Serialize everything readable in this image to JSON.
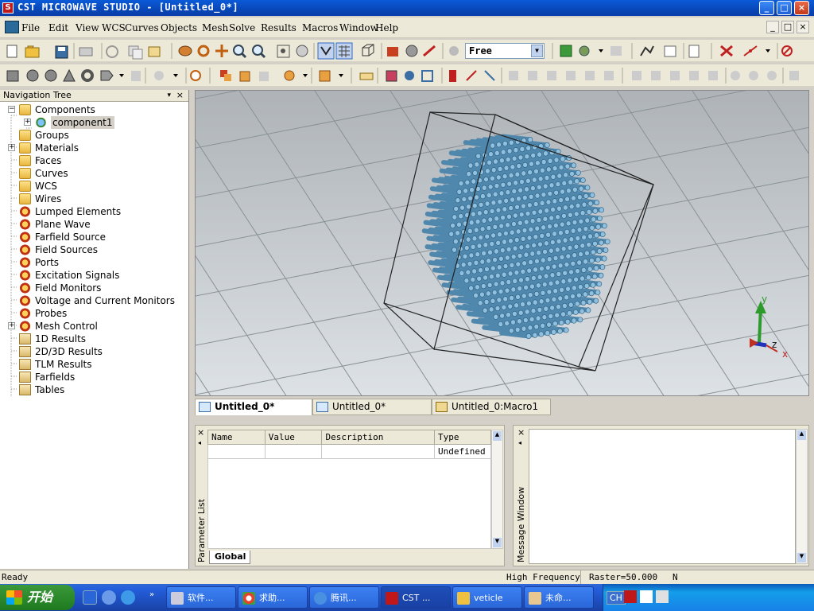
{
  "window": {
    "title": "CST MICROWAVE STUDIO - [Untitled_0*]",
    "logo_letter": "S",
    "controls": [
      "_",
      "□",
      "×"
    ]
  },
  "menubar": {
    "items": [
      "File",
      "Edit",
      "View",
      "WCS",
      "Curves",
      "Objects",
      "Mesh",
      "Solve",
      "Results",
      "Macros",
      "Window",
      "Help"
    ],
    "mdi_controls": [
      "_",
      "□",
      "×"
    ]
  },
  "toolbar": {
    "mode_select": "Free"
  },
  "navtree": {
    "header": "Navigation Tree",
    "pin": "▾",
    "close": "×",
    "items": [
      {
        "label": "Components",
        "icon": "folder-icon",
        "expander": "−"
      },
      {
        "label": "component1",
        "icon": "component-icon",
        "expander": "+"
      },
      {
        "label": "Groups",
        "icon": "folder-icon"
      },
      {
        "label": "Materials",
        "icon": "folder-icon",
        "expander": "+"
      },
      {
        "label": "Faces",
        "icon": "folder-icon"
      },
      {
        "label": "Curves",
        "icon": "folder-icon"
      },
      {
        "label": "WCS",
        "icon": "folder-icon"
      },
      {
        "label": "Wires",
        "icon": "folder-icon"
      },
      {
        "label": "Lumped Elements",
        "icon": "gear-icon"
      },
      {
        "label": "Plane Wave",
        "icon": "gear-icon"
      },
      {
        "label": "Farfield Source",
        "icon": "gear-icon"
      },
      {
        "label": "Field Sources",
        "icon": "gear-icon"
      },
      {
        "label": "Ports",
        "icon": "gear-icon"
      },
      {
        "label": "Excitation Signals",
        "icon": "gear-icon"
      },
      {
        "label": "Field Monitors",
        "icon": "gear-icon"
      },
      {
        "label": "Voltage and Current Monitors",
        "icon": "gear-icon"
      },
      {
        "label": "Probes",
        "icon": "gear-icon"
      },
      {
        "label": "Mesh Control",
        "icon": "gear-icon",
        "expander": "+"
      },
      {
        "label": "1D Results",
        "icon": "result-icon"
      },
      {
        "label": "2D/3D Results",
        "icon": "result-icon"
      },
      {
        "label": "TLM Results",
        "icon": "result-icon"
      },
      {
        "label": "Farfields",
        "icon": "result-icon"
      },
      {
        "label": "Tables",
        "icon": "result-icon"
      }
    ]
  },
  "viewport": {
    "axes": {
      "y": "y",
      "z": "z",
      "x": "x"
    },
    "background_color": "#b7bcc0",
    "model_color": "#4f87ad"
  },
  "doc_tabs": [
    {
      "label": "Untitled_0*",
      "active": true
    },
    {
      "label": "Untitled_0*",
      "active": false
    },
    {
      "label": "Untitled_0:Macro1",
      "active": false
    }
  ],
  "parameter_list": {
    "title": "Parameter List",
    "columns": [
      "Name",
      "Value",
      "Description",
      "Type"
    ],
    "rows": [
      [
        "",
        "",
        "",
        "Undefined"
      ]
    ],
    "tab": "Global",
    "close": "×",
    "arrow": "◂"
  },
  "message_window": {
    "title": "Message Window",
    "close": "×",
    "arrow": "◂"
  },
  "statusbar": {
    "left": "Ready",
    "mode": "High Frequency",
    "raster": "Raster=50.000",
    "extra": "N"
  },
  "taskbar": {
    "start": "开始",
    "tasks": [
      "软件...",
      "求助...",
      "腾讯...",
      "CST ...",
      "veticle",
      "未命..."
    ],
    "tray_lang": "CH"
  }
}
